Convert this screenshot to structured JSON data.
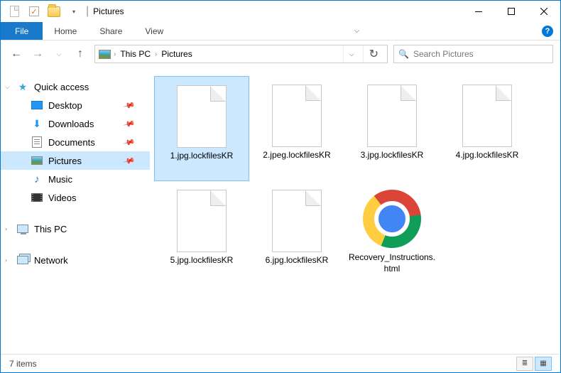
{
  "title": "Pictures",
  "ribbon": {
    "file": "File",
    "tabs": [
      "Home",
      "Share",
      "View"
    ]
  },
  "breadcrumbs": [
    "This PC",
    "Pictures"
  ],
  "search": {
    "placeholder": "Search Pictures"
  },
  "nav": {
    "quick_access": "Quick access",
    "items": [
      {
        "label": "Desktop",
        "pinned": true
      },
      {
        "label": "Downloads",
        "pinned": true
      },
      {
        "label": "Documents",
        "pinned": true
      },
      {
        "label": "Pictures",
        "pinned": true,
        "selected": true
      },
      {
        "label": "Music",
        "pinned": false
      },
      {
        "label": "Videos",
        "pinned": false
      }
    ],
    "this_pc": "This PC",
    "network": "Network"
  },
  "files": [
    {
      "name": "1.jpg.lockfilesKR",
      "type": "blank",
      "selected": true
    },
    {
      "name": "2.jpeg.lockfilesKR",
      "type": "blank"
    },
    {
      "name": "3.jpg.lockfilesKR",
      "type": "blank"
    },
    {
      "name": "4.jpg.lockfilesKR",
      "type": "blank"
    },
    {
      "name": "5.jpg.lockfilesKR",
      "type": "blank"
    },
    {
      "name": "6.jpg.lockfilesKR",
      "type": "blank"
    },
    {
      "name": "Recovery_Instructions.html",
      "type": "chrome"
    }
  ],
  "status": {
    "count": "7 items"
  }
}
